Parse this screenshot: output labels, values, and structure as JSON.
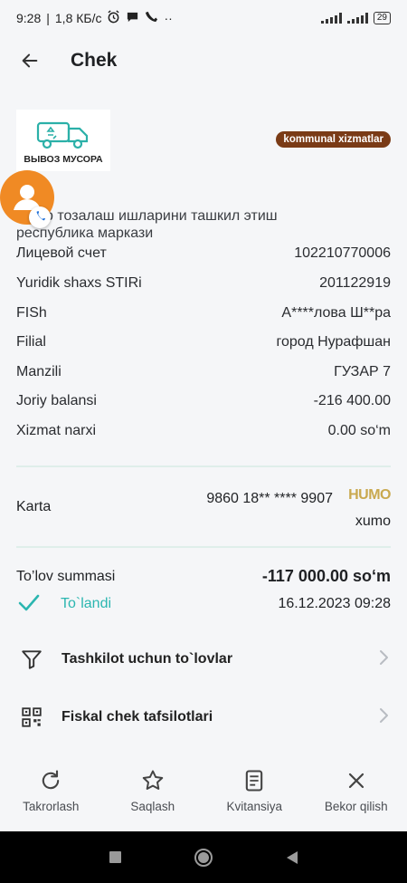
{
  "status_bar": {
    "time": "9:28",
    "net_speed": "1,8 КБ/с",
    "dots": "··",
    "battery": "29"
  },
  "header": {
    "title": "Chek"
  },
  "merchant": {
    "logo_text": "ВЫВОЗ МУСОРА",
    "category_badge": "kommunal xizmatlar",
    "org_name": "…тар тозалаш ишларини ташкил этиш республика маркази"
  },
  "details": [
    {
      "label": "Лицевой счет",
      "value": "102210770006"
    },
    {
      "label": "Yuridik shaxs STIRi",
      "value": "201122919"
    },
    {
      "label": "FISh",
      "value": "А****лова Ш**ра"
    },
    {
      "label": "Filial",
      "value": "город Нурафшан"
    },
    {
      "label": "Manzili",
      "value": "ГУЗАР 7"
    },
    {
      "label": "Joriy balansi",
      "value": "-216 400.00"
    },
    {
      "label": "Xizmat narxi",
      "value": "0.00 so‘m"
    }
  ],
  "card": {
    "label": "Karta",
    "number": "9860 18** **** 9907",
    "brand": "HUMO",
    "type": "xumo"
  },
  "payment": {
    "label": "To’lov summasi",
    "amount": "-117 000.00 so‘m",
    "status": "To`landi",
    "datetime": "16.12.2023 09:28"
  },
  "actions": [
    {
      "label": "Tashkilot uchun to`lovlar"
    },
    {
      "label": "Fiskal chek tafsilotlari"
    }
  ],
  "bottom_actions": [
    {
      "label": "Takrorlash",
      "icon": "repeat-icon"
    },
    {
      "label": "Saqlash",
      "icon": "star-icon"
    },
    {
      "label": "Kvitansiya",
      "icon": "receipt-icon"
    },
    {
      "label": "Bekor qilish",
      "icon": "close-icon"
    }
  ],
  "colors": {
    "badge": "#7a3b16",
    "accent": "#2bb6b0",
    "avatar": "#f08a24",
    "humo": "#c9a94f"
  }
}
